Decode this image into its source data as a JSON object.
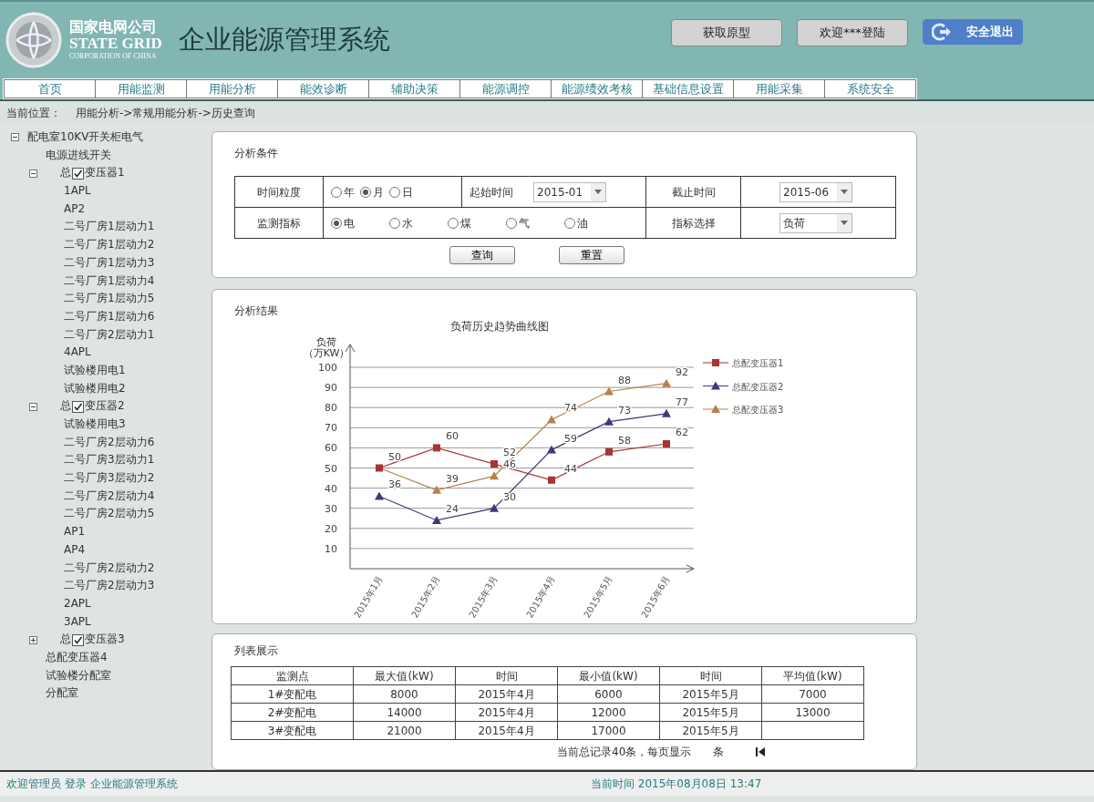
{
  "header": {
    "logo_cn": "国家电网公司",
    "logo_en": "STATE GRID",
    "logo_sub": "CORPORATION OF CHINA",
    "title": "企业能源管理系统",
    "buttons": [
      {
        "label": "获取原型",
        "kind": "plain"
      },
      {
        "label": "欢迎***登陆",
        "kind": "plain"
      },
      {
        "label": "安全退出",
        "kind": "logout"
      }
    ]
  },
  "nav": [
    "首页",
    "用能监测",
    "用能分析",
    "能效诊断",
    "辅助决策",
    "能源调控",
    "能源绩效考核",
    "基础信息设置",
    "用能采集",
    "系统安全"
  ],
  "breadcrumb": {
    "label": "当前位置：",
    "path": "用能分析->常规用能分析->历史查询"
  },
  "tree": [
    {
      "label": "配电室10KV开关柜电气",
      "expanded": true,
      "children": [
        {
          "label": "电源进线开关"
        },
        {
          "prefix": "总",
          "label": "变压器1",
          "checked": true,
          "expanded": true,
          "children": [
            {
              "label": "1APL"
            },
            {
              "label": "AP2"
            },
            {
              "label": "二号厂房1层动力1"
            },
            {
              "label": "二号厂房1层动力2"
            },
            {
              "label": "二号厂房1层动力3"
            },
            {
              "label": "二号厂房1层动力4"
            },
            {
              "label": "二号厂房1层动力5"
            },
            {
              "label": "二号厂房1层动力6"
            },
            {
              "label": "二号厂房2层动力1"
            },
            {
              "label": "4APL"
            },
            {
              "label": "试验楼用电1"
            },
            {
              "label": "试验楼用电2"
            }
          ]
        },
        {
          "prefix": "总",
          "label": "变压器2",
          "checked": true,
          "expanded": true,
          "children": [
            {
              "label": "试验楼用电3"
            },
            {
              "label": "二号厂房2层动力6"
            },
            {
              "label": "二号厂房3层动力1"
            },
            {
              "label": "二号厂房3层动力2"
            },
            {
              "label": "二号厂房2层动力4"
            },
            {
              "label": "二号厂房2层动力5"
            },
            {
              "label": "AP1"
            },
            {
              "label": "AP4"
            },
            {
              "label": "二号厂房2层动力2"
            },
            {
              "label": "二号厂房2层动力3"
            },
            {
              "label": "2APL"
            },
            {
              "label": "3APL"
            }
          ]
        },
        {
          "prefix": "总",
          "label": "变压器3",
          "checked": true,
          "expanded": false
        },
        {
          "label": "总配变压器4"
        },
        {
          "label": "试验楼分配室"
        },
        {
          "label": "分配室"
        }
      ]
    }
  ],
  "conditions": {
    "title": "分析条件",
    "granularity": {
      "label": "时间粒度",
      "options": [
        {
          "label": "年",
          "selected": false
        },
        {
          "label": "月",
          "selected": true
        },
        {
          "label": "日",
          "selected": false
        }
      ]
    },
    "start": {
      "label": "起始时间",
      "value": "2015-01"
    },
    "end": {
      "label": "截止时间",
      "value": "2015-06"
    },
    "indicator": {
      "label": "监测指标",
      "options": [
        {
          "label": "电",
          "selected": true
        },
        {
          "label": "水",
          "selected": false
        },
        {
          "label": "煤",
          "selected": false
        },
        {
          "label": "气",
          "selected": false
        },
        {
          "label": "油",
          "selected": false
        }
      ]
    },
    "metric": {
      "label": "指标选择",
      "value": "负荷"
    },
    "buttons": [
      "查询",
      "重置"
    ]
  },
  "result": {
    "title": "分析结果",
    "chart_data": {
      "type": "line",
      "title": "负荷历史趋势曲线图",
      "ylabel": "负荷（万KW）",
      "categories": [
        "2015年1月",
        "2015年2月",
        "2015年3月",
        "2015年4月",
        "2015年5月",
        "2015年6月"
      ],
      "ylim": [
        0,
        100
      ],
      "yticks": [
        10,
        20,
        30,
        40,
        50,
        60,
        70,
        80,
        90,
        100
      ],
      "grid": true,
      "legend": true,
      "value_labels": [
        [
          "50",
          "60",
          "52",
          "44",
          "58",
          "62"
        ],
        [
          "36",
          "24",
          "30",
          "59",
          "73",
          "77"
        ],
        [
          null,
          "39",
          "46",
          "74",
          "88",
          "92"
        ]
      ],
      "series": [
        {
          "name": "总配变压器1",
          "color": "#a83434",
          "marker": "square",
          "values": [
            50,
            60,
            52,
            44,
            58,
            62
          ]
        },
        {
          "name": "总配变压器2",
          "color": "#3a3a7c",
          "marker": "triangle",
          "values": [
            36,
            24,
            30,
            59,
            73,
            77
          ]
        },
        {
          "name": "总配变压器3",
          "color": "#b8804a",
          "marker": "triangle",
          "values": [
            50,
            39,
            46,
            74,
            88,
            92
          ]
        }
      ]
    }
  },
  "list": {
    "title": "列表展示",
    "columns": [
      "监测点",
      "最大值(kW)",
      "时间",
      "最小值(kW)",
      "时间",
      "平均值(kW)"
    ],
    "rows": [
      [
        "1#变配电",
        "8000",
        "2015年4月",
        "6000",
        "2015年5月",
        "7000"
      ],
      [
        "2#变配电",
        "14000",
        "2015年4月",
        "12000",
        "2015年5月",
        "13000"
      ],
      [
        "3#变配电",
        "21000",
        "2015年4月",
        "17000",
        "2015年5月"
      ]
    ],
    "pager": {
      "summary": "当前总记录40条，每页显示",
      "unit": "条"
    }
  },
  "footer": {
    "user": "欢迎管理员 登录 企业能源管理系统",
    "time": "当前时间 2015年08月08日 13:47"
  }
}
